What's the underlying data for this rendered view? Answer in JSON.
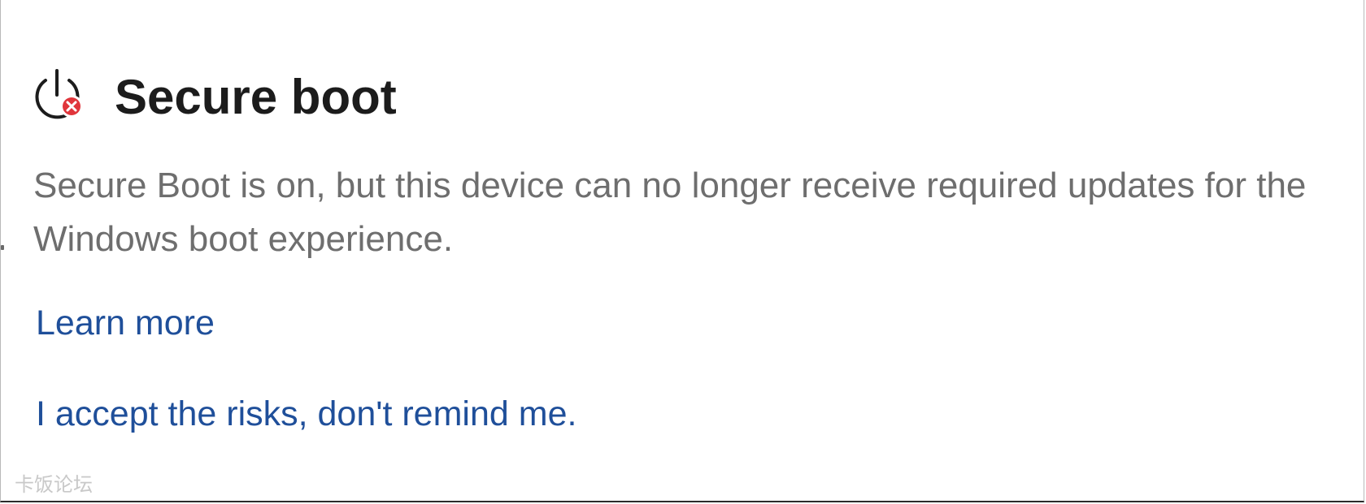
{
  "header": {
    "title": "Secure boot",
    "icon": "power-error-icon",
    "icon_error_color": "#e0353b"
  },
  "main": {
    "description": "Secure Boot is on, but this device can no longer receive required updates for the Windows boot experience.",
    "learn_more_label": "Learn more",
    "accept_risks_label": "I accept the risks, don't remind me."
  },
  "watermark": {
    "text": "卡饭论坛"
  },
  "colors": {
    "link": "#1f4f9a",
    "title": "#1c1c1c",
    "body_text": "#6e6e6e"
  }
}
